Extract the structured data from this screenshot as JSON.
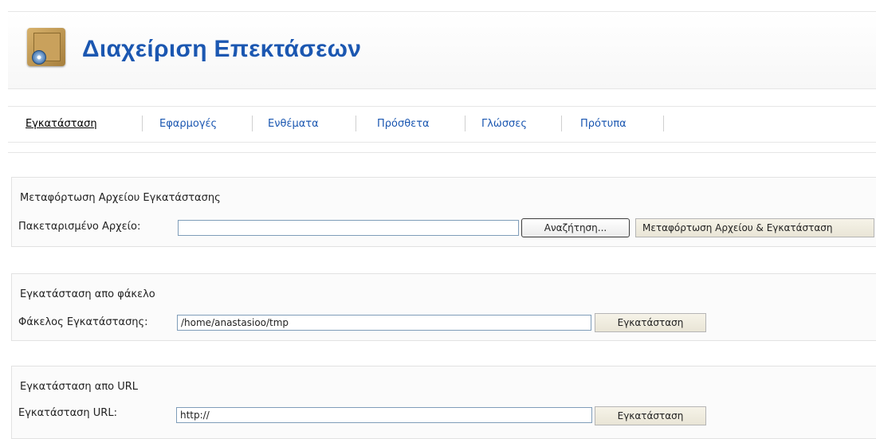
{
  "header": {
    "title": "Διαχείριση Επεκτάσεων",
    "icon": "extension-manager-icon"
  },
  "tabs": [
    {
      "label": "Εγκατάσταση",
      "active": true
    },
    {
      "label": "Εφαρμογές",
      "active": false
    },
    {
      "label": "Ενθέματα",
      "active": false
    },
    {
      "label": "Πρόσθετα",
      "active": false
    },
    {
      "label": "Γλώσσες",
      "active": false
    },
    {
      "label": "Πρότυπα",
      "active": false
    }
  ],
  "upload": {
    "title": "Μεταφόρτωση Αρχείου Εγκατάστασης",
    "label": "Πακεταρισμένο Αρχείο:",
    "value": "",
    "browse": "Αναζήτηση...",
    "submit": "Μεταφόρτωση Αρχείου & Εγκατάσταση"
  },
  "folder": {
    "title": "Εγκατάσταση απο φάκελο",
    "label": "Φάκελος Εγκατάστασης:",
    "value": "/home/anastasioo/tmp",
    "submit": "Εγκατάσταση"
  },
  "url": {
    "title": "Εγκατάσταση απο URL",
    "label": "Εγκατάσταση URL:",
    "value": "http://",
    "submit": "Εγκατάσταση"
  },
  "colors": {
    "title": "#1b57b1",
    "link": "#1b57b1"
  }
}
